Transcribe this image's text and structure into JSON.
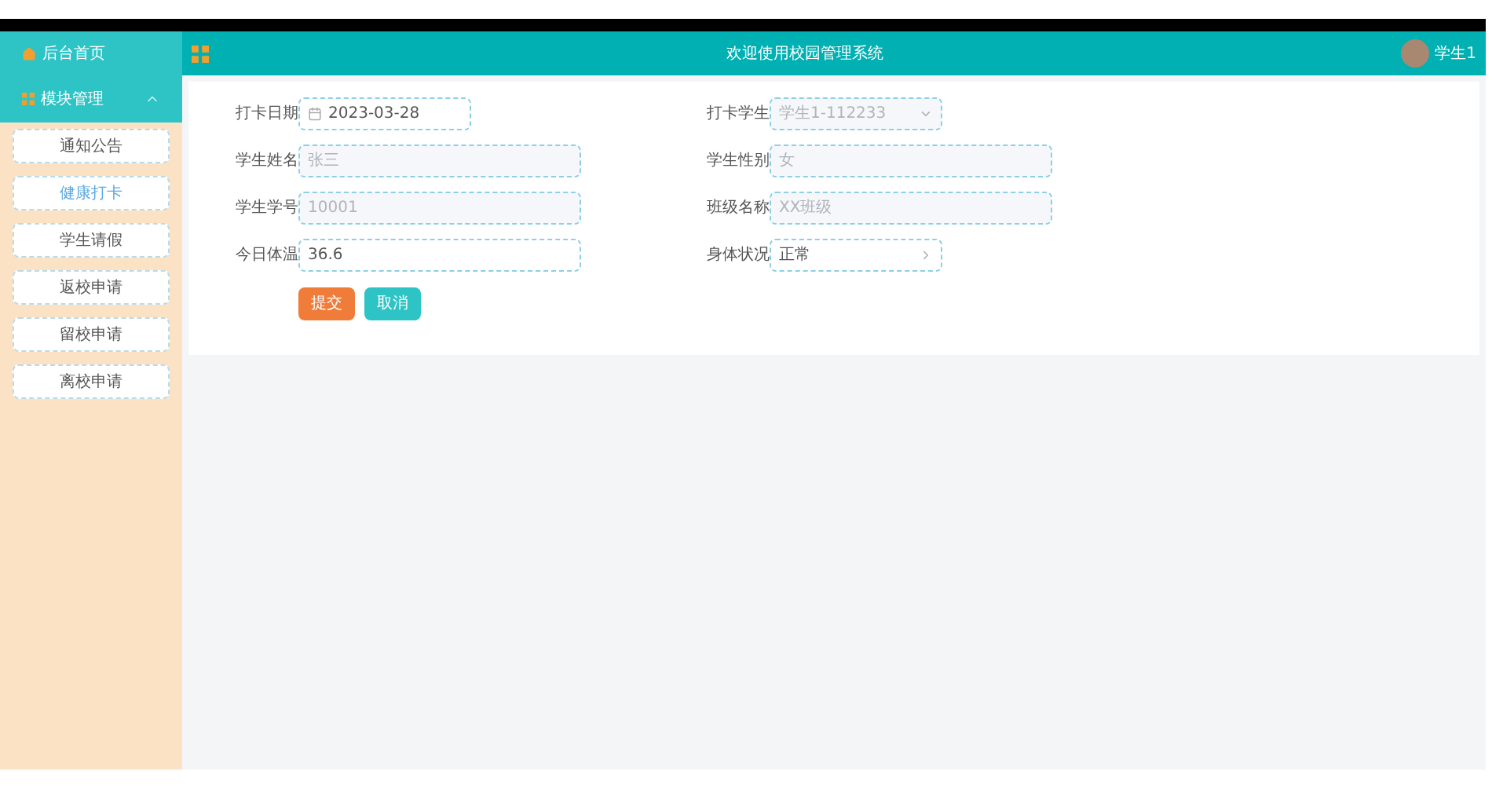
{
  "header": {
    "title": "欢迎使用校园管理系统",
    "user": "学生1"
  },
  "sidebar": {
    "home": "后台首页",
    "group": {
      "label": "模块管理",
      "expanded": true
    },
    "items": [
      {
        "label": "通知公告",
        "selected": false
      },
      {
        "label": "健康打卡",
        "selected": true
      },
      {
        "label": "学生请假",
        "selected": false
      },
      {
        "label": "返校申请",
        "selected": false
      },
      {
        "label": "留校申请",
        "selected": false
      },
      {
        "label": "离校申请",
        "selected": false
      }
    ]
  },
  "form": {
    "rows": [
      [
        {
          "label": "打卡日期",
          "kind": "date",
          "value": "2023-03-28",
          "disabled": false
        },
        {
          "label": "打卡学生",
          "kind": "select",
          "value": "学生1-112233",
          "disabled": true
        }
      ],
      [
        {
          "label": "学生姓名",
          "kind": "text",
          "value": "张三",
          "disabled": true
        },
        {
          "label": "学生性别",
          "kind": "text",
          "value": "女",
          "disabled": true
        }
      ],
      [
        {
          "label": "学生学号",
          "kind": "text",
          "value": "10001",
          "disabled": true
        },
        {
          "label": "班级名称",
          "kind": "text",
          "value": "XX班级",
          "disabled": true
        }
      ],
      [
        {
          "label": "今日体温",
          "kind": "text",
          "value": "36.6",
          "disabled": false
        },
        {
          "label": "身体状况",
          "kind": "cascader",
          "value": "正常",
          "disabled": false
        }
      ]
    ],
    "buttons": [
      {
        "label": "提交",
        "kind": "primary"
      },
      {
        "label": "取消",
        "kind": "secondary"
      }
    ]
  }
}
